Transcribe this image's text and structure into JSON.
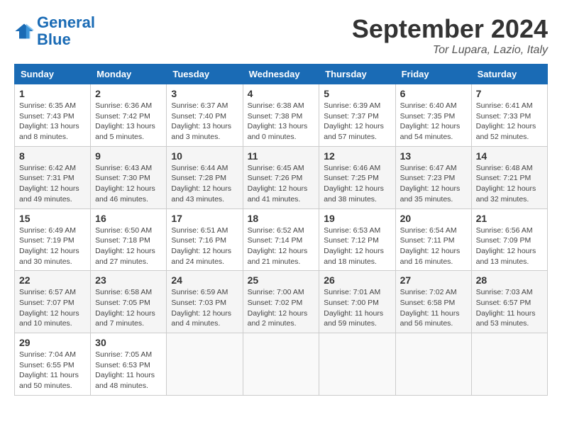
{
  "header": {
    "logo_line1": "General",
    "logo_line2": "Blue",
    "month_title": "September 2024",
    "location": "Tor Lupara, Lazio, Italy"
  },
  "weekdays": [
    "Sunday",
    "Monday",
    "Tuesday",
    "Wednesday",
    "Thursday",
    "Friday",
    "Saturday"
  ],
  "weeks": [
    [
      {
        "day": "1",
        "sunrise": "6:35 AM",
        "sunset": "7:43 PM",
        "daylight": "13 hours and 8 minutes."
      },
      {
        "day": "2",
        "sunrise": "6:36 AM",
        "sunset": "7:42 PM",
        "daylight": "13 hours and 5 minutes."
      },
      {
        "day": "3",
        "sunrise": "6:37 AM",
        "sunset": "7:40 PM",
        "daylight": "13 hours and 3 minutes."
      },
      {
        "day": "4",
        "sunrise": "6:38 AM",
        "sunset": "7:38 PM",
        "daylight": "13 hours and 0 minutes."
      },
      {
        "day": "5",
        "sunrise": "6:39 AM",
        "sunset": "7:37 PM",
        "daylight": "12 hours and 57 minutes."
      },
      {
        "day": "6",
        "sunrise": "6:40 AM",
        "sunset": "7:35 PM",
        "daylight": "12 hours and 54 minutes."
      },
      {
        "day": "7",
        "sunrise": "6:41 AM",
        "sunset": "7:33 PM",
        "daylight": "12 hours and 52 minutes."
      }
    ],
    [
      {
        "day": "8",
        "sunrise": "6:42 AM",
        "sunset": "7:31 PM",
        "daylight": "12 hours and 49 minutes."
      },
      {
        "day": "9",
        "sunrise": "6:43 AM",
        "sunset": "7:30 PM",
        "daylight": "12 hours and 46 minutes."
      },
      {
        "day": "10",
        "sunrise": "6:44 AM",
        "sunset": "7:28 PM",
        "daylight": "12 hours and 43 minutes."
      },
      {
        "day": "11",
        "sunrise": "6:45 AM",
        "sunset": "7:26 PM",
        "daylight": "12 hours and 41 minutes."
      },
      {
        "day": "12",
        "sunrise": "6:46 AM",
        "sunset": "7:25 PM",
        "daylight": "12 hours and 38 minutes."
      },
      {
        "day": "13",
        "sunrise": "6:47 AM",
        "sunset": "7:23 PM",
        "daylight": "12 hours and 35 minutes."
      },
      {
        "day": "14",
        "sunrise": "6:48 AM",
        "sunset": "7:21 PM",
        "daylight": "12 hours and 32 minutes."
      }
    ],
    [
      {
        "day": "15",
        "sunrise": "6:49 AM",
        "sunset": "7:19 PM",
        "daylight": "12 hours and 30 minutes."
      },
      {
        "day": "16",
        "sunrise": "6:50 AM",
        "sunset": "7:18 PM",
        "daylight": "12 hours and 27 minutes."
      },
      {
        "day": "17",
        "sunrise": "6:51 AM",
        "sunset": "7:16 PM",
        "daylight": "12 hours and 24 minutes."
      },
      {
        "day": "18",
        "sunrise": "6:52 AM",
        "sunset": "7:14 PM",
        "daylight": "12 hours and 21 minutes."
      },
      {
        "day": "19",
        "sunrise": "6:53 AM",
        "sunset": "7:12 PM",
        "daylight": "12 hours and 18 minutes."
      },
      {
        "day": "20",
        "sunrise": "6:54 AM",
        "sunset": "7:11 PM",
        "daylight": "12 hours and 16 minutes."
      },
      {
        "day": "21",
        "sunrise": "6:56 AM",
        "sunset": "7:09 PM",
        "daylight": "12 hours and 13 minutes."
      }
    ],
    [
      {
        "day": "22",
        "sunrise": "6:57 AM",
        "sunset": "7:07 PM",
        "daylight": "12 hours and 10 minutes."
      },
      {
        "day": "23",
        "sunrise": "6:58 AM",
        "sunset": "7:05 PM",
        "daylight": "12 hours and 7 minutes."
      },
      {
        "day": "24",
        "sunrise": "6:59 AM",
        "sunset": "7:03 PM",
        "daylight": "12 hours and 4 minutes."
      },
      {
        "day": "25",
        "sunrise": "7:00 AM",
        "sunset": "7:02 PM",
        "daylight": "12 hours and 2 minutes."
      },
      {
        "day": "26",
        "sunrise": "7:01 AM",
        "sunset": "7:00 PM",
        "daylight": "11 hours and 59 minutes."
      },
      {
        "day": "27",
        "sunrise": "7:02 AM",
        "sunset": "6:58 PM",
        "daylight": "11 hours and 56 minutes."
      },
      {
        "day": "28",
        "sunrise": "7:03 AM",
        "sunset": "6:57 PM",
        "daylight": "11 hours and 53 minutes."
      }
    ],
    [
      {
        "day": "29",
        "sunrise": "7:04 AM",
        "sunset": "6:55 PM",
        "daylight": "11 hours and 50 minutes."
      },
      {
        "day": "30",
        "sunrise": "7:05 AM",
        "sunset": "6:53 PM",
        "daylight": "11 hours and 48 minutes."
      },
      null,
      null,
      null,
      null,
      null
    ]
  ],
  "labels": {
    "sunrise": "Sunrise:",
    "sunset": "Sunset:",
    "daylight": "Daylight:"
  }
}
